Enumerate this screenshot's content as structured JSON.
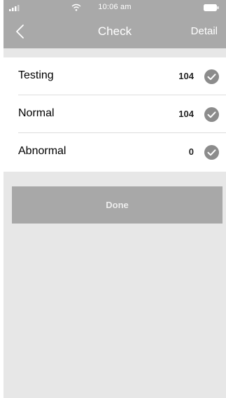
{
  "status_bar": {
    "time": "10:06 am"
  },
  "nav": {
    "title": "Check",
    "detail_label": "Detail",
    "back_icon": "chevron-left-icon"
  },
  "list": {
    "items": [
      {
        "label": "Testing",
        "count": "104",
        "icon": "checkmark-circle-icon"
      },
      {
        "label": "Normal",
        "count": "104",
        "icon": "checkmark-circle-icon"
      },
      {
        "label": "Abnormal",
        "count": "0",
        "icon": "checkmark-circle-icon"
      }
    ]
  },
  "done_button": {
    "label": "Done"
  },
  "colors": {
    "header": "#a9a9a9",
    "background": "#e7e7e7",
    "check_circle": "#8c8c8c",
    "done_button": "#a8a8a8"
  }
}
